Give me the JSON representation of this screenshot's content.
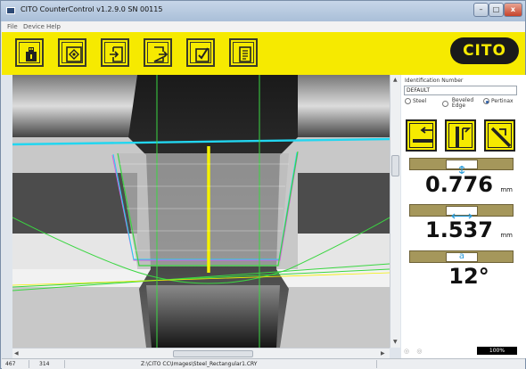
{
  "window": {
    "title": "CITO CounterControl v1.2.9.0 SN 00115",
    "min_glyph": "–",
    "max_glyph": "□",
    "close_glyph": "x"
  },
  "menu": [
    "File",
    "Device",
    "Help"
  ],
  "toolbar": {
    "buttons": [
      "device-icon",
      "target-icon",
      "export-icon",
      "import-icon",
      "checklist-icon",
      "report-icon"
    ],
    "logo_text": "CITO"
  },
  "panel": {
    "id_label": "Identification Number",
    "id_value": "DEFAULT",
    "materials": [
      "Steel",
      "Beveled Edge",
      "Pertinax"
    ],
    "material_selected": "Pertinax",
    "material_beveled_line1": "Beveled",
    "material_beveled_line2": "Edge",
    "measure_buttons": [
      "horizontal-measure-icon",
      "vertical-measure-icon",
      "angle-measure-icon"
    ],
    "depth": {
      "value": "0.776",
      "unit": "mm"
    },
    "width": {
      "value": "1.537",
      "unit": "mm"
    },
    "angle": {
      "value": "12°",
      "badge": "a"
    },
    "zoom": "100%"
  },
  "status": {
    "x": "467",
    "y": "314",
    "file": "Z:\\CITO CC\\Images\\Steel_Rectangular1.CRY"
  },
  "colors": {
    "brand_yellow": "#f6ea00",
    "bar_olive": "#a5975b",
    "overlay_cyan": "#22d6f0",
    "overlay_green": "#3bd642",
    "overlay_yellow": "#f4f000",
    "overlay_magenta": "#d85be0"
  }
}
